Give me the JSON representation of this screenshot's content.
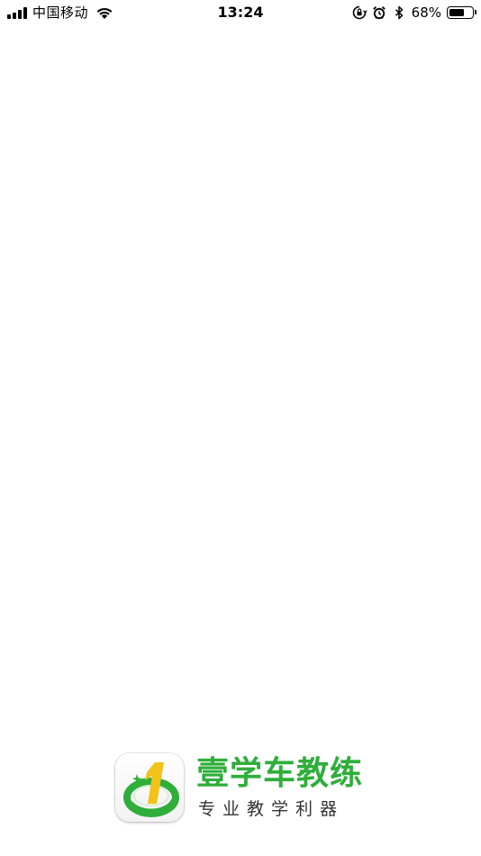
{
  "status_bar": {
    "carrier": "中国移动",
    "time": "13:24",
    "battery_percent_text": "68%",
    "battery_level": 0.68,
    "icons": [
      "signal-icon",
      "wifi-icon",
      "orientation-lock-icon",
      "alarm-icon",
      "bluetooth-icon",
      "battery-icon"
    ]
  },
  "splash": {
    "app_name": "壹学车教练",
    "slogan": "专业教学利器",
    "logo_icon": "app-logo-icon",
    "colors": {
      "brand_green": "#2fae3a",
      "logo_yellow": "#f2c21a",
      "slogan_gray": "#333333",
      "background": "#ffffff"
    }
  }
}
